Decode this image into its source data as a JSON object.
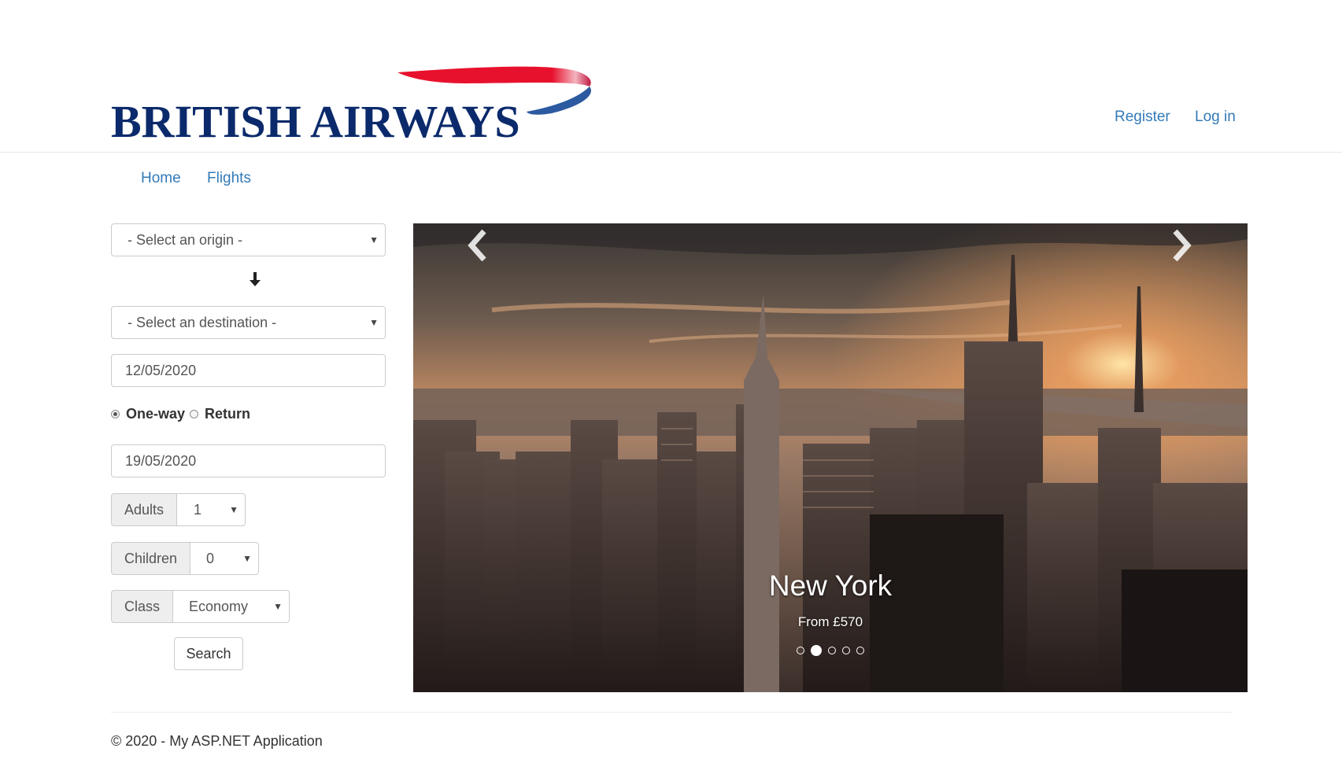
{
  "header": {
    "logo_text": "BRITISH AIRWAYS",
    "register_label": "Register",
    "login_label": "Log in"
  },
  "nav": {
    "items": [
      {
        "label": "Home"
      },
      {
        "label": "Flights"
      }
    ]
  },
  "search_form": {
    "origin": {
      "selected": "- Select an origin -"
    },
    "destination": {
      "selected": "- Select an destination -"
    },
    "depart_date": "12/05/2020",
    "trip_type": {
      "options": [
        {
          "label": "One-way",
          "checked": true
        },
        {
          "label": "Return",
          "checked": false
        }
      ]
    },
    "return_date": "19/05/2020",
    "adults": {
      "label": "Adults",
      "value": "1"
    },
    "children": {
      "label": "Children",
      "value": "0"
    },
    "class": {
      "label": "Class",
      "value": "Economy"
    },
    "search_label": "Search",
    "icons": {
      "direction": "arrow-down-icon",
      "caret": "caret-down-icon"
    }
  },
  "carousel": {
    "slide_title": "New York",
    "slide_subtitle": "From £570",
    "slide_count": 5,
    "active_index": 1,
    "icons": {
      "prev": "chevron-left-icon",
      "next": "chevron-right-icon"
    }
  },
  "footer": {
    "text": "© 2020 - My ASP.NET Application"
  },
  "colors": {
    "link": "#337ab7",
    "brand_navy": "#0b2a6b",
    "brand_red": "#e8112d",
    "brand_blue": "#2c5aa0"
  }
}
